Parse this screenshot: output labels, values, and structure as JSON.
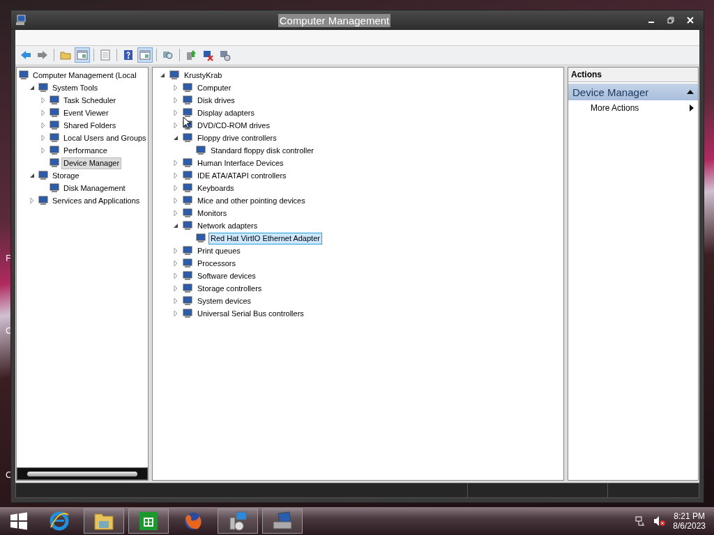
{
  "desktop_labels": [
    "F",
    "C",
    "C"
  ],
  "window": {
    "title": "Computer Management"
  },
  "toolbar": [
    {
      "kind": "back",
      "on": false
    },
    {
      "kind": "forward",
      "on": false
    },
    {
      "kind": "separator"
    },
    {
      "kind": "folder",
      "on": false
    },
    {
      "kind": "panel",
      "on": true
    },
    {
      "kind": "separator"
    },
    {
      "kind": "sheet",
      "on": false
    },
    {
      "kind": "separator"
    },
    {
      "kind": "help",
      "on": false
    },
    {
      "kind": "panel",
      "on": true
    },
    {
      "kind": "separator"
    },
    {
      "kind": "scan",
      "on": false
    },
    {
      "kind": "separator"
    },
    {
      "kind": "update",
      "on": false
    },
    {
      "kind": "remove",
      "on": false
    },
    {
      "kind": "install",
      "on": false
    }
  ],
  "console_tree": [
    {
      "label": "Computer Management (Local",
      "selected": false,
      "children": [
        {
          "label": "System Tools",
          "expanded": true,
          "selected": false,
          "children": [
            {
              "label": "Task Scheduler",
              "expanded": false,
              "selected": false
            },
            {
              "label": "Event Viewer",
              "expanded": false,
              "selected": false
            },
            {
              "label": "Shared Folders",
              "expanded": false,
              "selected": false
            },
            {
              "label": "Local Users and Groups",
              "expanded": false,
              "selected": false
            },
            {
              "label": "Performance",
              "expanded": false,
              "selected": false
            },
            {
              "label": "Device Manager",
              "selected": true
            }
          ]
        },
        {
          "label": "Storage",
          "expanded": true,
          "selected": false,
          "children": [
            {
              "label": "Disk Management",
              "selected": false
            }
          ]
        },
        {
          "label": "Services and Applications",
          "expanded": false,
          "selected": false
        }
      ]
    }
  ],
  "device_tree": [
    {
      "label": "KrustyKrab",
      "expanded": true,
      "selected": false,
      "children": [
        {
          "label": "Computer",
          "expanded": false,
          "selected": false
        },
        {
          "label": "Disk drives",
          "expanded": false,
          "selected": false
        },
        {
          "label": "Display adapters",
          "expanded": false,
          "selected": false
        },
        {
          "label": "DVD/CD-ROM drives",
          "expanded": false,
          "selected": false
        },
        {
          "label": "Floppy drive controllers",
          "expanded": true,
          "selected": false,
          "children": [
            {
              "label": "Standard floppy disk controller",
              "selected": false
            }
          ]
        },
        {
          "label": "Human Interface Devices",
          "expanded": false,
          "selected": false
        },
        {
          "label": "IDE ATA/ATAPI controllers",
          "expanded": false,
          "selected": false
        },
        {
          "label": "Keyboards",
          "expanded": false,
          "selected": false
        },
        {
          "label": "Mice and other pointing devices",
          "expanded": false,
          "selected": false
        },
        {
          "label": "Monitors",
          "expanded": false,
          "selected": false
        },
        {
          "label": "Network adapters",
          "expanded": true,
          "selected": false,
          "children": [
            {
              "label": "Red Hat VirtIO Ethernet Adapter",
              "selected": true
            }
          ]
        },
        {
          "label": "Print queues",
          "expanded": false,
          "selected": false
        },
        {
          "label": "Processors",
          "expanded": false,
          "selected": false
        },
        {
          "label": "Software devices",
          "expanded": false,
          "selected": false
        },
        {
          "label": "Storage controllers",
          "expanded": false,
          "selected": false
        },
        {
          "label": "System devices",
          "expanded": false,
          "selected": false
        },
        {
          "label": "Universal Serial Bus controllers",
          "expanded": false,
          "selected": false
        }
      ]
    }
  ],
  "actions": {
    "header": "Actions",
    "section": {
      "title": "Device Manager",
      "expanded": true
    },
    "items": [
      "More Actions"
    ]
  },
  "taskbar": {
    "apps": [
      {
        "kind": "browser",
        "running": false
      },
      {
        "kind": "folder",
        "running": true
      },
      {
        "kind": "store",
        "running": true
      },
      {
        "kind": "firefox",
        "running": false
      },
      {
        "kind": "management",
        "running": true
      },
      {
        "kind": "devices",
        "running": true
      }
    ],
    "time": "8:21 PM",
    "date": "8/6/2023"
  }
}
